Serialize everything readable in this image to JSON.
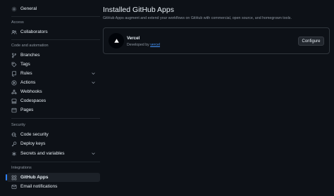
{
  "sidebar": {
    "general": "General",
    "sections": {
      "access": "Access",
      "code_automation": "Code and automation",
      "security": "Security",
      "integrations": "Integrations"
    },
    "items": {
      "collaborators": "Collaborators",
      "branches": "Branches",
      "tags": "Tags",
      "rules": "Rules",
      "actions": "Actions",
      "webhooks": "Webhooks",
      "codespaces": "Codespaces",
      "pages": "Pages",
      "code_security": "Code security",
      "deploy_keys": "Deploy keys",
      "secrets_variables": "Secrets and variables",
      "github_apps": "GitHub Apps",
      "email_notifications": "Email notifications"
    },
    "active_item": "github_apps"
  },
  "main": {
    "title": "Installed GitHub Apps",
    "subtitle": "GitHub Apps augment and extend your workflows on GitHub with commercial, open source, and homegrown tools.",
    "apps": [
      {
        "name": "Vercel",
        "developed_by_label": "Developed by",
        "developer": "vercel",
        "configure_label": "Configure",
        "logo_icon": "triangle-logo-icon"
      }
    ]
  },
  "colors": {
    "background": "#0d1117",
    "text": "#e6edf3",
    "muted": "#8d96a0",
    "accent": "#2f81f7",
    "link": "#4493f8",
    "border": "#30363d"
  }
}
